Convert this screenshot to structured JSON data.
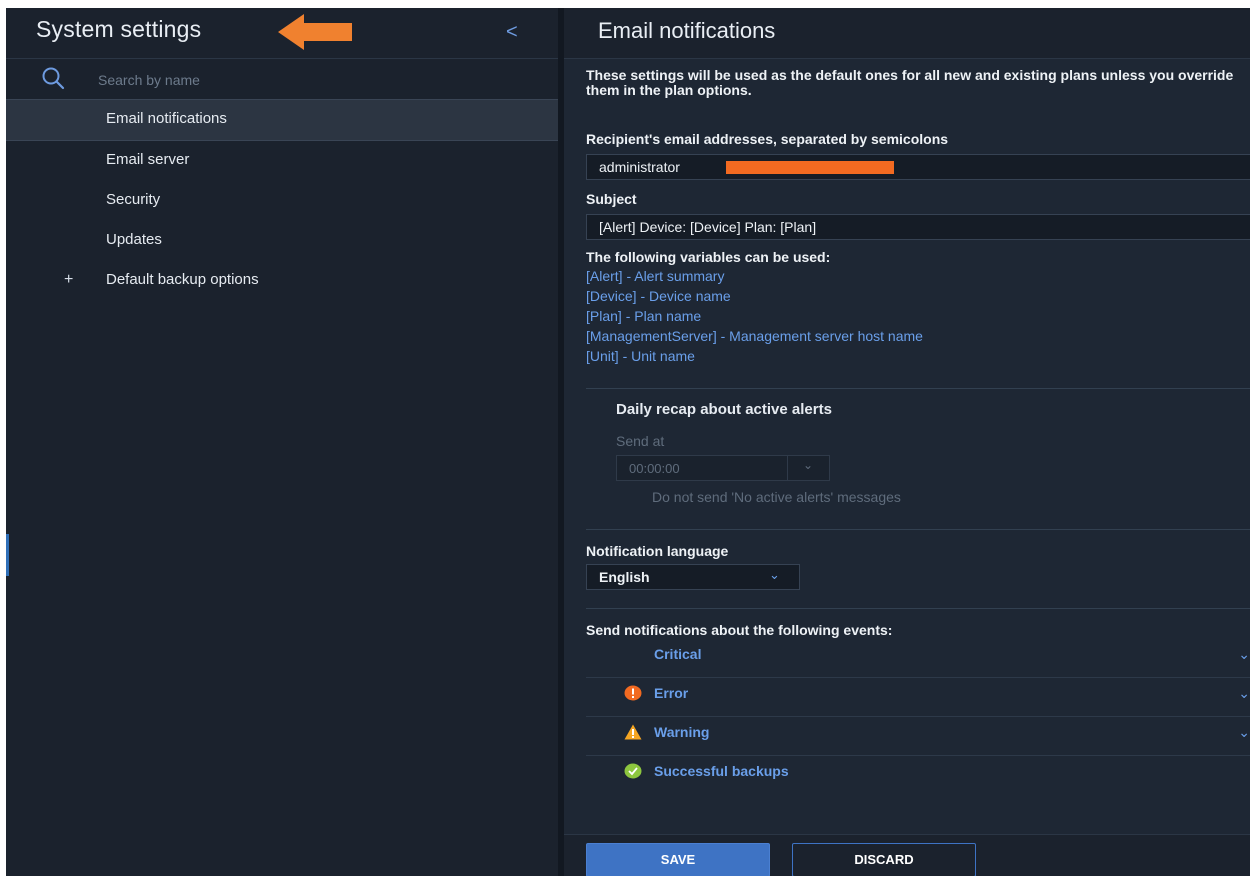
{
  "sidebar": {
    "title": "System settings",
    "collapse_glyph": "<",
    "search": {
      "placeholder": "Search by name",
      "icon": "search-icon"
    },
    "items": [
      {
        "label": "Email notifications",
        "active": true
      },
      {
        "label": "Email server"
      },
      {
        "label": "Security"
      },
      {
        "label": "Updates"
      },
      {
        "label": "Default backup options",
        "expandable": true,
        "expand_glyph": "+"
      }
    ]
  },
  "main": {
    "title": "Email notifications",
    "intro": "These settings will be used as the default ones for all new and existing plans unless you override them in the plan options.",
    "recipients": {
      "label": "Recipient's email addresses, separated by semicolons",
      "value": "administrator"
    },
    "subject": {
      "label": "Subject",
      "value": "[Alert] Device: [Device] Plan: [Plan]"
    },
    "variables": {
      "title": "The following variables can be used:",
      "items": [
        "[Alert] - Alert summary",
        "[Device] - Device name",
        "[Plan] - Plan name",
        "[ManagementServer] - Management server host name",
        "[Unit] - Unit name"
      ]
    },
    "recap": {
      "title": "Daily recap about active alerts",
      "send_at_label": "Send at",
      "time_value": "00:00:00",
      "no_alerts_text": "Do not send 'No active alerts' messages"
    },
    "language": {
      "label": "Notification language",
      "value": "English"
    },
    "events": {
      "title": "Send notifications about the following events:",
      "items": [
        {
          "label": "Critical",
          "icon": "none"
        },
        {
          "label": "Error",
          "icon": "error-icon"
        },
        {
          "label": "Warning",
          "icon": "warning-icon"
        },
        {
          "label": "Successful backups",
          "icon": "success-icon"
        }
      ]
    },
    "buttons": {
      "save": "SAVE",
      "discard": "DISCARD"
    }
  },
  "colors": {
    "accent": "#3e73c4",
    "link": "#6a9fea",
    "annotation_arrow": "#f0812f",
    "redaction": "#f26a21",
    "error": "#f26a21",
    "warning": "#f5a623",
    "success": "#8dc63f"
  }
}
